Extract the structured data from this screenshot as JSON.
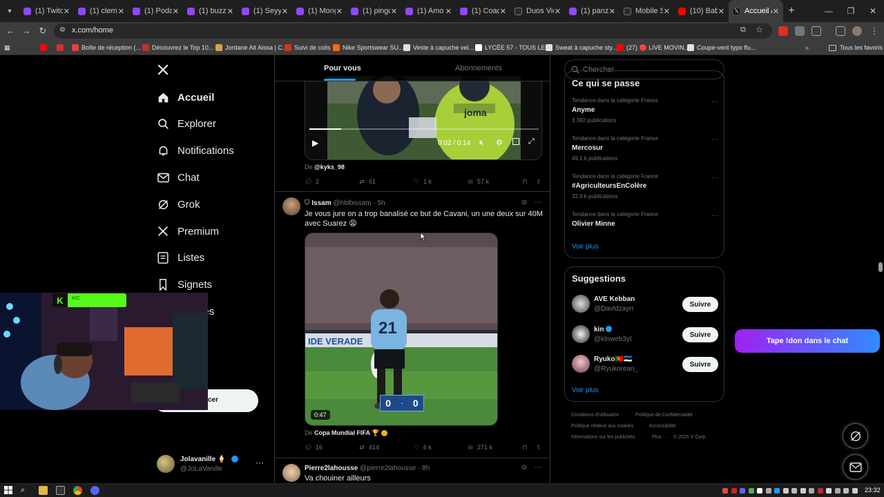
{
  "browser": {
    "tabs": [
      {
        "label": "(1) Twitch",
        "icon": "twitch-icon",
        "color": "#9146ff"
      },
      {
        "label": "(1) clemen",
        "icon": "twitch-icon",
        "color": "#9146ff"
      },
      {
        "label": "(1) Podas",
        "icon": "twitch-icon",
        "color": "#9146ff"
      },
      {
        "label": "(1) buzzb",
        "icon": "twitch-icon",
        "color": "#9146ff"
      },
      {
        "label": "(1) Seyyt",
        "icon": "twitch-icon",
        "color": "#9146ff"
      },
      {
        "label": "(1) Mong",
        "icon": "twitch-icon",
        "color": "#9146ff"
      },
      {
        "label": "(1) pingc",
        "icon": "twitch-icon",
        "color": "#9146ff"
      },
      {
        "label": "(1) Amo",
        "icon": "twitch-icon",
        "color": "#9146ff"
      },
      {
        "label": "(1) Coach",
        "icon": "twitch-icon",
        "color": "#9146ff"
      },
      {
        "label": "Duos Vic",
        "icon": "game-icon",
        "color": "#2a2a2a"
      },
      {
        "label": "(1) panz",
        "icon": "twitch-icon",
        "color": "#9146ff"
      },
      {
        "label": "Mobile S",
        "icon": "mobile-icon",
        "color": "#2a2a2a"
      },
      {
        "label": "(10) Bab",
        "icon": "youtube-icon",
        "color": "#ff0000"
      },
      {
        "label": "Accueil / X",
        "icon": "x-logo-icon",
        "color": "#000000"
      }
    ],
    "url": "x.com/home",
    "bookmarks": [
      {
        "label": "",
        "color": "#ff0000"
      },
      {
        "label": "",
        "color": "#d93025"
      },
      {
        "label": "Boîte de réception (...",
        "color": "#ea4335"
      },
      {
        "label": "Découvrez le Top 10...",
        "color": "#c4302b"
      },
      {
        "label": "Jordane Ait Aissa | C...",
        "color": "#d7a24a"
      },
      {
        "label": "Suivi de colis",
        "color": "#d93025"
      },
      {
        "label": "Nike Sportswear SU...",
        "color": "#ff6a00"
      },
      {
        "label": "Veste à capuche vel...",
        "color": "#e0e0e0"
      },
      {
        "label": "LYCÉE 57 - TOUS LE...",
        "color": "#ffffff"
      },
      {
        "label": "Sweat à capuche sty...",
        "color": "#e0e0e0"
      },
      {
        "label": "(27) 🔴 LIVE MOVIN...",
        "color": "#ff0000"
      },
      {
        "label": "Coupe-vent typo flu...",
        "color": "#e0e0e0"
      }
    ],
    "all_bookmarks": "Tous les favoris",
    "window_controls": [
      "—",
      "❐",
      "✕"
    ]
  },
  "nav": {
    "items": [
      {
        "label": "Accueil",
        "icon": "home-icon"
      },
      {
        "label": "Explorer",
        "icon": "search-icon"
      },
      {
        "label": "Notifications",
        "icon": "bell-icon"
      },
      {
        "label": "Chat",
        "icon": "mail-icon"
      },
      {
        "label": "Grok",
        "icon": "grok-icon"
      },
      {
        "label": "Premium",
        "icon": "x-logo-icon"
      },
      {
        "label": "Listes",
        "icon": "list-icon"
      },
      {
        "label": "Signets",
        "icon": "bookmark-icon"
      },
      {
        "label": "unautés",
        "icon": "communities-icon"
      }
    ],
    "post_button": "cer",
    "account": {
      "name": "Jolavanille 🍦",
      "handle": "@JoLaVanille"
    }
  },
  "feed": {
    "tabs": [
      "Pour vous",
      "Abonnements"
    ],
    "tweet1": {
      "video_time": "0:02 / 0:14",
      "source_prefix": "De",
      "source": "@kyks_98",
      "replies": "2",
      "reposts": "61",
      "likes": "1 k",
      "views": "57 k",
      "video_progress": 0.14
    },
    "tweet2": {
      "name": "Issam",
      "handle": "@hblbissam",
      "time": "· 5h",
      "text": "Je vous jure on a trop banalisé ce but de Cavani, un une deux sur 40M avec Suarez 😩",
      "duration": "0:47",
      "score_left": "0",
      "score_right": "0",
      "source_prefix": "De",
      "source": "Copa Mundial FIFA 🏆",
      "replies": "16",
      "reposts": "414",
      "likes": "6 k",
      "views": "271 k"
    },
    "tweet3": {
      "name": "Pierre2lahousse",
      "handle": "@pierre2lahousse",
      "time": "· 8h",
      "text": "Va chouiner ailleurs"
    }
  },
  "right": {
    "search_placeholder": "Chercher",
    "trends_title": "Ce qui se passe",
    "trends": [
      {
        "category": "Tendance dans la catégorie France",
        "name": "Anyme",
        "count": "3 392 publications"
      },
      {
        "category": "Tendance dans la catégorie France",
        "name": "Mercosur",
        "count": "49,1 k publications"
      },
      {
        "category": "Tendance dans la catégorie France",
        "name": "#AgriculteursEnColère",
        "count": "32,9 k publications"
      },
      {
        "category": "Tendance dans la catégorie France",
        "name": "Olivier Minne",
        "count": ""
      }
    ],
    "see_more": "Voir plus",
    "suggestions_title": "Suggestions",
    "suggestions": [
      {
        "name": "AVE Kebban",
        "handle": "@Davldzayrr",
        "button": "Suivre"
      },
      {
        "name": "kin",
        "handle": "@klnweb3yt",
        "button": "Suivre"
      },
      {
        "name": "Ryuko🇵🇹🇪🇪",
        "handle": "@Ryukorean_",
        "button": "Suivre"
      }
    ],
    "footer": [
      "Conditions d'utilisation",
      "Politique de Confidentialité",
      "Politique relative aux cookies",
      "Accessibilité",
      "Informations sur les publicités",
      "Plus ···",
      "© 2025 X Corp."
    ]
  },
  "overlay": {
    "donate_text": "Tape !don dans le chat",
    "webcam_badge": "KIC"
  },
  "taskbar": {
    "time": "23:32"
  }
}
